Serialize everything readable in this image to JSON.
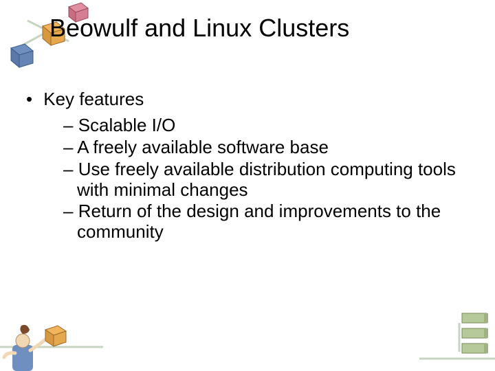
{
  "title": "Beowulf and Linux Clusters",
  "l1": {
    "bullet_glyph": "•",
    "text": "Key features"
  },
  "l2": {
    "dash_glyph": "–",
    "items": [
      "Scalable I/O",
      "A freely available software base",
      "Use freely available distribution computing tools with minimal changes",
      "Return of the design and improvements to the community"
    ]
  }
}
